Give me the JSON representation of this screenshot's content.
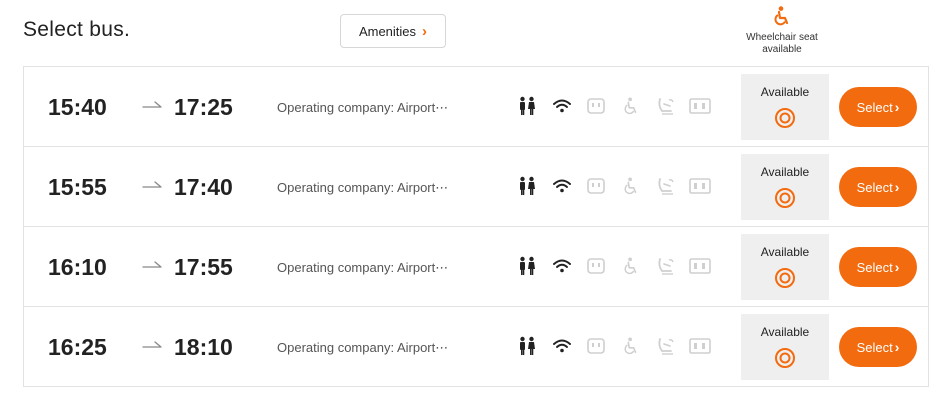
{
  "header": {
    "title": "Select bus.",
    "amenities_label": "Amenities",
    "wheelchair_seat_label_1": "Wheelchair seat",
    "wheelchair_seat_label_2": "available"
  },
  "colors": {
    "accent": "#f26b0f",
    "disabled_icon": "#cfcfcf",
    "active_icon": "#222222"
  },
  "buses": [
    {
      "departure": "15:40",
      "arrival": "17:25",
      "company": "Operating company: Airport⋯",
      "wheelchair_status": "Available",
      "select_label": "Select"
    },
    {
      "departure": "15:55",
      "arrival": "17:40",
      "company": "Operating company: Airport⋯",
      "wheelchair_status": "Available",
      "select_label": "Select"
    },
    {
      "departure": "16:10",
      "arrival": "17:55",
      "company": "Operating company: Airport⋯",
      "wheelchair_status": "Available",
      "select_label": "Select"
    },
    {
      "departure": "16:25",
      "arrival": "18:10",
      "company": "Operating company: Airport⋯",
      "wheelchair_status": "Available",
      "select_label": "Select"
    }
  ],
  "amenity_icons": [
    {
      "name": "restroom-icon",
      "active": true
    },
    {
      "name": "wifi-icon",
      "active": true
    },
    {
      "name": "power-outlet-icon",
      "active": false
    },
    {
      "name": "wheelchair-icon",
      "active": false
    },
    {
      "name": "reclining-seat-icon",
      "active": false
    },
    {
      "name": "monitor-icon",
      "active": false
    }
  ],
  "availability_mark_icon": "double-circle-icon",
  "select_chevron_icon": "chevron-right-icon"
}
